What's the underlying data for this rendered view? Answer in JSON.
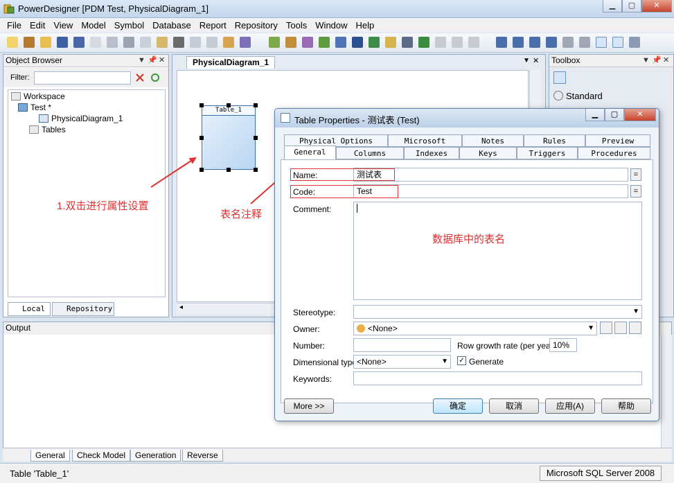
{
  "window": {
    "title": "PowerDesigner [PDM Test, PhysicalDiagram_1]",
    "min": "▁",
    "max": "▢",
    "close": "✕"
  },
  "menu": [
    "File",
    "Edit",
    "View",
    "Model",
    "Symbol",
    "Database",
    "Report",
    "Repository",
    "Tools",
    "Window",
    "Help"
  ],
  "object_browser": {
    "title": "Object Browser",
    "filter_label": "Filter:",
    "tree": [
      "Workspace",
      "Test *",
      "PhysicalDiagram_1",
      "Tables"
    ],
    "tabs": [
      "Local",
      "Repository"
    ]
  },
  "diagram": {
    "tab": "PhysicalDiagram_1",
    "table_name": "Table_1"
  },
  "toolbox": {
    "title": "Toolbox",
    "section": "Standard"
  },
  "output": {
    "title": "Output",
    "tabs": [
      "General",
      "Check Model",
      "Generation",
      "Reverse"
    ]
  },
  "status": {
    "left": "Table 'Table_1'",
    "right": "Microsoft SQL Server 2008"
  },
  "dialog": {
    "title": "Table Properties - 测试表 (Test)",
    "tabs_row1": [
      "Physical Options",
      "Microsoft",
      "Notes",
      "Rules",
      "Preview"
    ],
    "tabs_row2": [
      "General",
      "Columns",
      "Indexes",
      "Keys",
      "Triggers",
      "Procedures"
    ],
    "name_label": "Name:",
    "name_value": "测试表",
    "code_label": "Code:",
    "code_value": "Test",
    "comment_label": "Comment:",
    "stereotype_label": "Stereotype:",
    "owner_label": "Owner:",
    "owner_value": "<None>",
    "number_label": "Number:",
    "row_growth_label": "Row growth rate (per year):",
    "row_growth_value": "10%",
    "dimensional_label": "Dimensional type:",
    "dimensional_value": "<None>",
    "generate_label": "Generate",
    "keywords_label": "Keywords:",
    "more_button": "More >>",
    "ok_button": "确定",
    "cancel_button": "取消",
    "apply_button": "应用(A)",
    "help_button": "帮助",
    "eq": "="
  },
  "annotations": {
    "double_click": "1.双击进行属性设置",
    "table_comment": "表名注释",
    "db_table_name": "数据库中的表名"
  },
  "colors": {
    "annotation": "#e03030"
  }
}
